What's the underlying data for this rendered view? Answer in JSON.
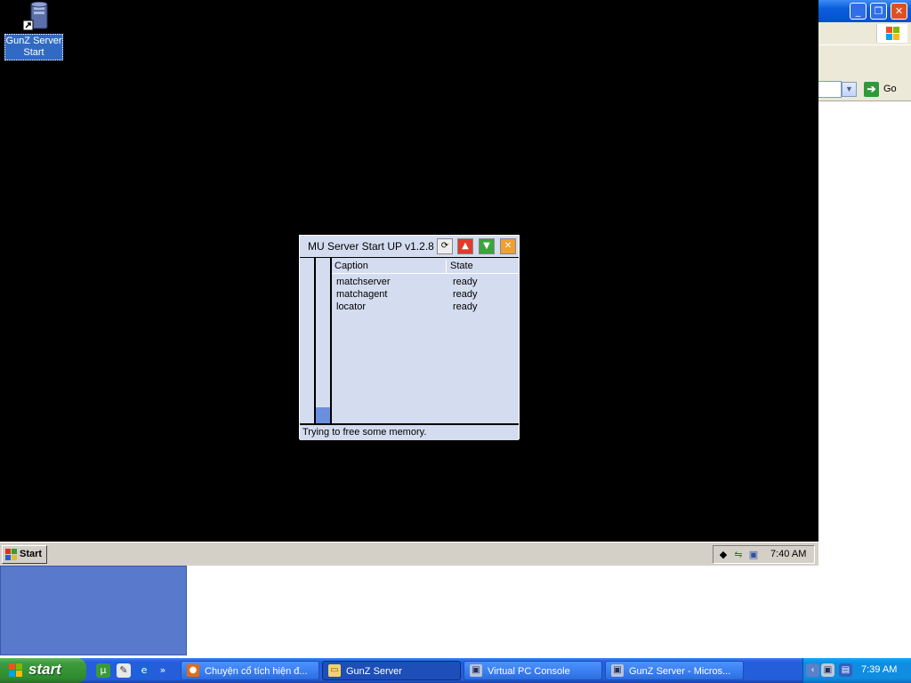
{
  "desktop": {
    "icon_label": "GunZ Server Start"
  },
  "app": {
    "title": "MU Server Start UP v1.2.8",
    "columns": [
      "Caption",
      "State"
    ],
    "rows": [
      {
        "caption": "matchserver",
        "state": "ready"
      },
      {
        "caption": "matchagent",
        "state": "ready"
      },
      {
        "caption": "locator",
        "state": "ready"
      }
    ],
    "status": "Trying to free some memory."
  },
  "guest_taskbar": {
    "start_label": "Start",
    "clock": "7:40 AM"
  },
  "host_window": {
    "go_label": "Go"
  },
  "host_taskbar": {
    "start_label": "start",
    "quicklaunch_more": "»",
    "tasks": [
      {
        "label": "Chuyện cổ tích hiện đ...",
        "icon": "firefox-icon"
      },
      {
        "label": "GunZ Server",
        "icon": "folder-icon"
      },
      {
        "label": "Virtual PC Console",
        "icon": "virtual-pc-icon"
      },
      {
        "label": "GunZ Server - Micros...",
        "icon": "virtual-pc-icon"
      }
    ],
    "clock": "7:39 AM"
  },
  "colors": {
    "app_bg": "#d4dcf0",
    "xp_taskbar": "#245edb",
    "xp_start": "#3c9c3c"
  }
}
